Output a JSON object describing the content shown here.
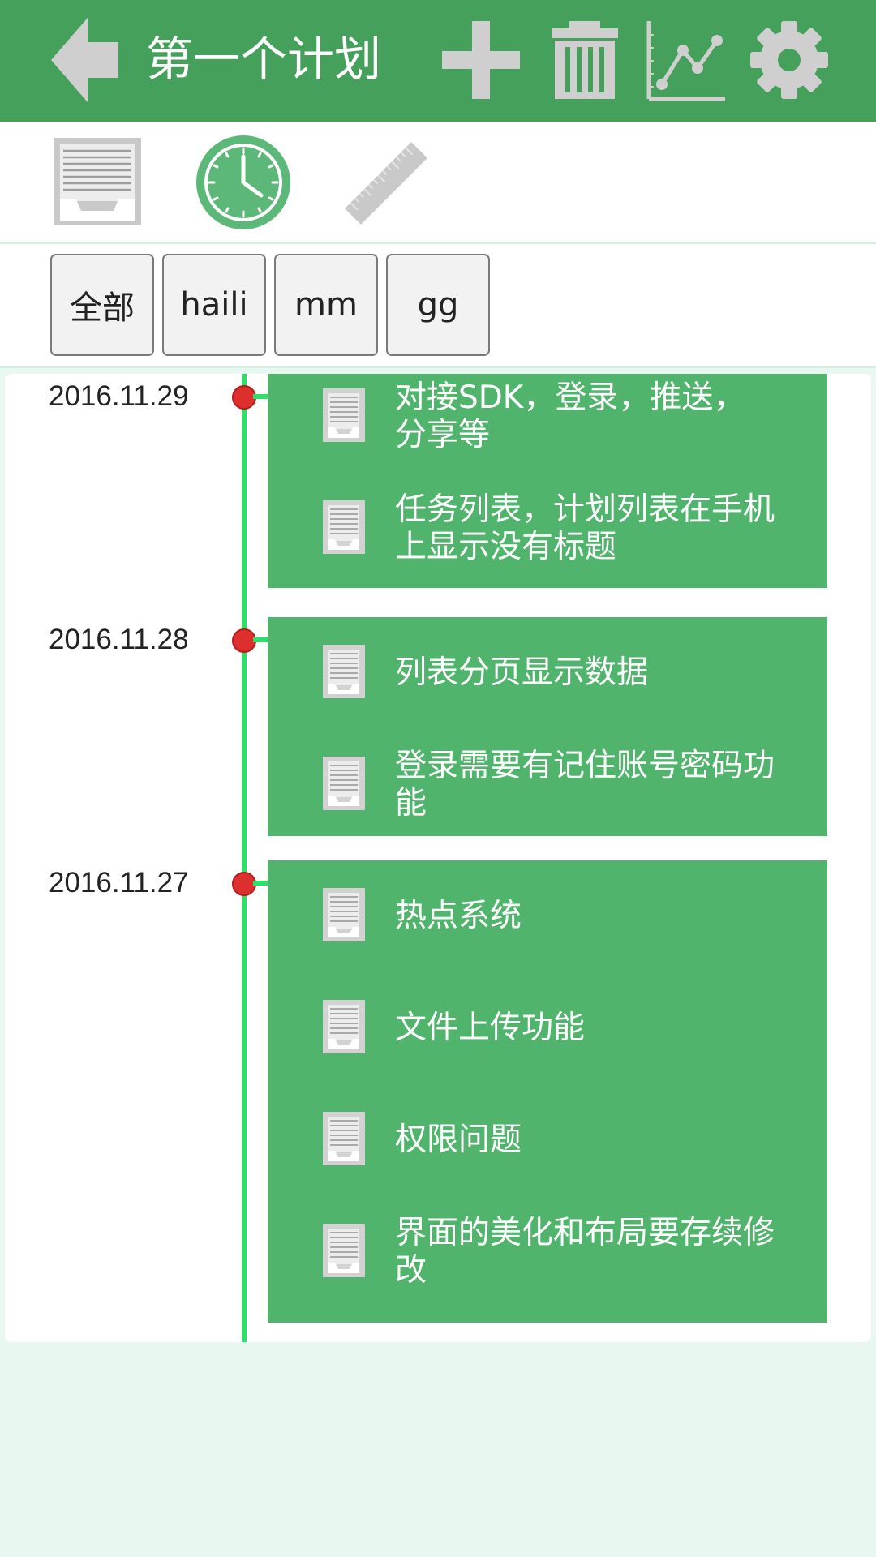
{
  "header": {
    "title": "第一个计划",
    "icons": [
      "back-arrow-icon",
      "add-icon",
      "trash-icon",
      "chart-icon",
      "gear-icon"
    ]
  },
  "modes": [
    "document-tray-icon",
    "clock-icon",
    "ruler-icon"
  ],
  "filters": [
    "全部",
    "haili",
    "mm",
    "gg"
  ],
  "colors": {
    "header": "#44a05a",
    "card": "#50b46c",
    "timeline": "#2ee06a",
    "dot": "#de2f2f",
    "background": "#e8f7ef",
    "clock": "#5cb878"
  },
  "timeline": [
    {
      "date": "2016.11.29",
      "tasks": [
        "对接SDK，登录，推送，分享等",
        "任务列表，计划列表在手机上显示没有标题"
      ]
    },
    {
      "date": "2016.11.28",
      "tasks": [
        "列表分页显示数据",
        "登录需要有记住账号密码功能"
      ]
    },
    {
      "date": "2016.11.27",
      "tasks": [
        "热点系统",
        "文件上传功能",
        "权限问题",
        "界面的美化和布局要存续修改"
      ]
    }
  ]
}
